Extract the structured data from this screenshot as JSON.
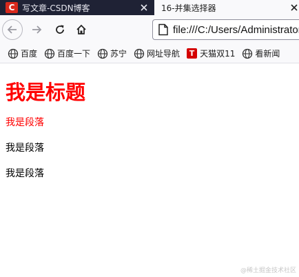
{
  "tabs": [
    {
      "title": "写文章-CSDN博客",
      "favicon_letter": "C",
      "active": false
    },
    {
      "title": "16-并集选择器",
      "active": true
    }
  ],
  "toolbar": {
    "url": "file:///C:/Users/Administrator"
  },
  "bookmarks": [
    {
      "label": "百度",
      "icon": "globe-icon"
    },
    {
      "label": "百度一下",
      "icon": "globe-icon"
    },
    {
      "label": "苏宁",
      "icon": "globe-icon"
    },
    {
      "label": "网址导航",
      "icon": "globe-icon"
    },
    {
      "label": "天猫双11",
      "icon": "tmall-icon",
      "icon_letter": "T"
    },
    {
      "label": "看新闻",
      "icon": "globe-icon"
    }
  ],
  "page": {
    "heading": "我是标题",
    "paragraphs": [
      "我是段落",
      "我是段落",
      "我是段落"
    ]
  },
  "watermark": "@稀土掘金技术社区",
  "colors": {
    "heading": "#ff0000",
    "first_paragraph": "#ff0000",
    "tab_strip": "#1f2235",
    "csdn_red": "#d9291c"
  }
}
